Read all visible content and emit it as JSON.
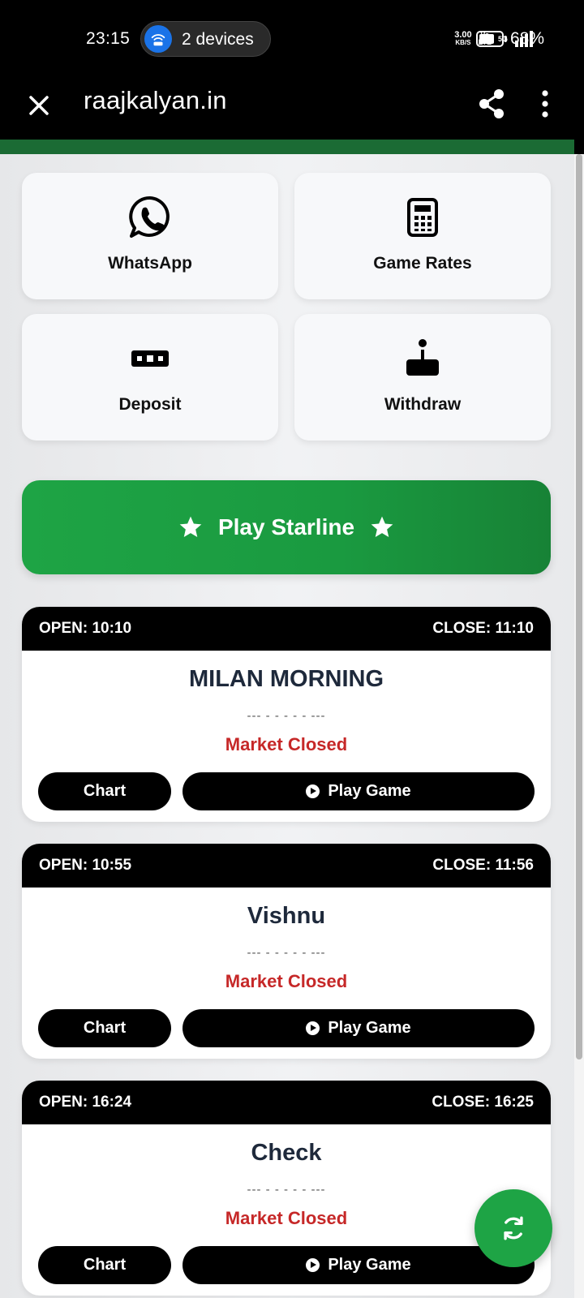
{
  "status_bar": {
    "time": "23:15",
    "hotspot_label": "2 devices",
    "speed": "3.00",
    "speed_unit": "KB/S",
    "volte_top": "Vo",
    "volte_bottom": "LTE",
    "network": "5G",
    "battery_percent": "68%",
    "battery_level": 0.68
  },
  "app_bar": {
    "title": "raajkalyan.in",
    "icons": [
      "close-icon",
      "share-icon",
      "more-vert-icon"
    ]
  },
  "quick_actions": [
    {
      "label": "WhatsApp",
      "icon": "whatsapp-icon"
    },
    {
      "label": "Game Rates",
      "icon": "calculator-icon"
    },
    {
      "label": "Deposit",
      "icon": "deposit-icon"
    },
    {
      "label": "Withdraw",
      "icon": "withdraw-icon"
    }
  ],
  "starline": {
    "label": "Play Starline",
    "icon": "star-icon"
  },
  "markets": [
    {
      "open": "OPEN: 10:10",
      "close": "CLOSE: 11:10",
      "name": "MILAN MORNING",
      "result": "--- - - - - - ---",
      "status": "Market Closed",
      "chart_label": "Chart",
      "play_label": "Play Game"
    },
    {
      "open": "OPEN: 10:55",
      "close": "CLOSE: 11:56",
      "name": "Vishnu",
      "result": "--- - - - - - ---",
      "status": "Market Closed",
      "chart_label": "Chart",
      "play_label": "Play Game"
    },
    {
      "open": "OPEN: 16:24",
      "close": "CLOSE: 16:25",
      "name": "Check",
      "result": "--- - - - - - ---",
      "status": "Market Closed",
      "chart_label": "Chart",
      "play_label": "Play Game"
    }
  ],
  "fab": {
    "icon": "refresh-icon"
  },
  "colors": {
    "accent_green": "#1ea445",
    "header_green": "#1b6b34",
    "closed_red": "#c62828"
  }
}
